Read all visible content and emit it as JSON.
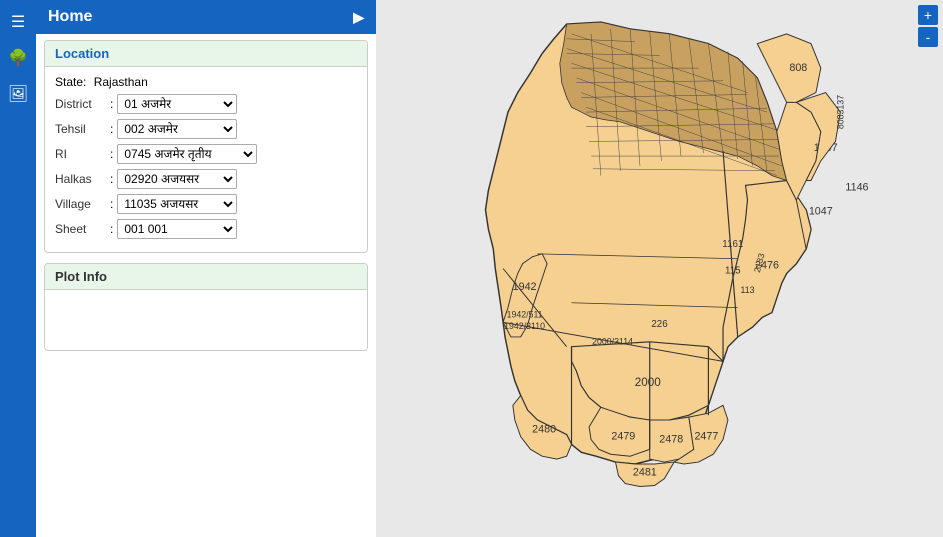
{
  "app": {
    "title": "Home"
  },
  "sidebar": {
    "icons": [
      {
        "name": "menu-icon",
        "symbol": "☰"
      },
      {
        "name": "tree-icon",
        "symbol": "🌲"
      },
      {
        "name": "image-icon",
        "symbol": "🖼"
      }
    ]
  },
  "location": {
    "section_title": "Location",
    "state_label": "State",
    "state_value": "Rajasthan",
    "district_label": "District",
    "district_value": "01 अजमेर",
    "tehsil_label": "Tehsil",
    "tehsil_value": "002 अजमेर",
    "ri_label": "RI",
    "ri_value": "0745 अजमेर तृतीय",
    "halkas_label": "Halkas",
    "halkas_value": "02920 अजयसर",
    "village_label": "Village",
    "village_value": "11035 अजयसर",
    "sheet_label": "Sheet",
    "sheet_value": "001 001",
    "district_options": [
      "01 अजमेर"
    ],
    "tehsil_options": [
      "002 अजमेर"
    ],
    "ri_options": [
      "0745 अजमेर तृतीय"
    ],
    "halkas_options": [
      "02920 अजयसर"
    ],
    "village_options": [
      "11035 अजयसर"
    ],
    "sheet_options": [
      "001 001"
    ]
  },
  "plot_info": {
    "section_title": "Plot Info"
  },
  "map": {
    "zoom_in_label": "+",
    "zoom_out_label": "-"
  }
}
